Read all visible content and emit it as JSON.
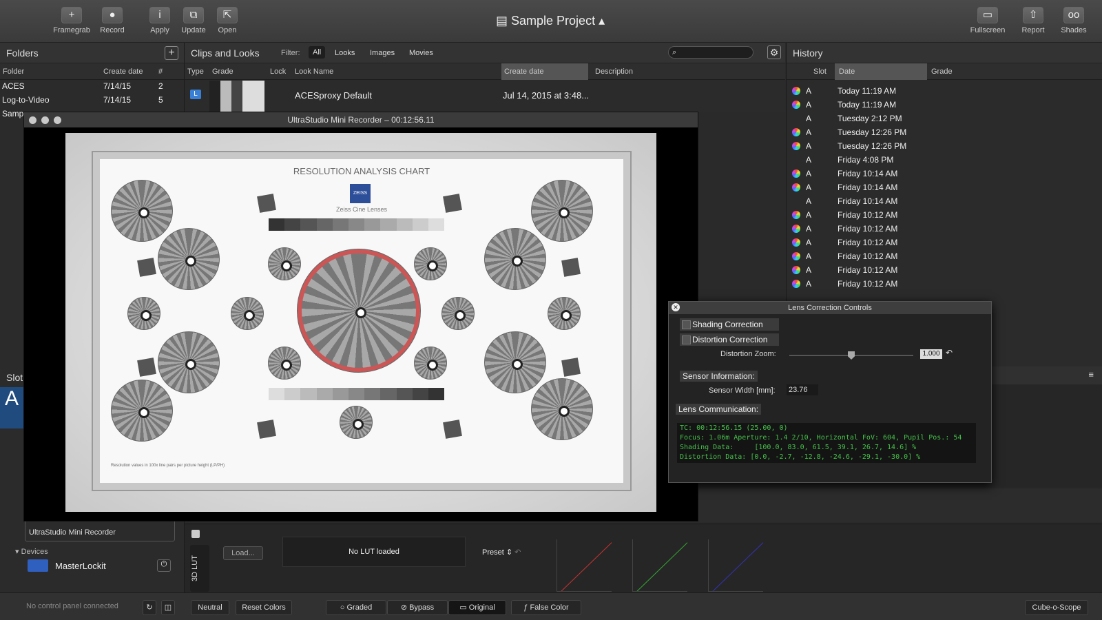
{
  "toolbar": {
    "buttons": [
      "Framegrab",
      "Record",
      "Apply",
      "Update",
      "Open"
    ],
    "right_buttons": [
      "Fullscreen",
      "Report",
      "Shades"
    ],
    "project_title": "Sample Project"
  },
  "folders": {
    "title": "Folders",
    "columns": [
      "Folder",
      "Create date",
      "#"
    ],
    "rows": [
      {
        "name": "ACES",
        "date": "7/14/15",
        "count": "2"
      },
      {
        "name": "Log-to-Video",
        "date": "7/14/15",
        "count": "5"
      },
      {
        "name": "Samp",
        "date": "",
        "count": ""
      }
    ],
    "add_icon": "plus-icon"
  },
  "clips": {
    "title": "Clips and Looks",
    "filter_label": "Filter:",
    "filters": [
      "All",
      "Looks",
      "Images",
      "Movies"
    ],
    "columns": [
      "Type",
      "Grade",
      "Lock",
      "Look Name",
      "Create date",
      "Description"
    ],
    "rows": [
      {
        "type": "L",
        "look_name": "ACESproxy Default",
        "date": "Jul 14, 2015 at 3:48..."
      }
    ]
  },
  "history": {
    "title": "History",
    "columns": [
      "Slot",
      "Date",
      "Grade"
    ],
    "rows": [
      {
        "slot": "A",
        "date": "Today 11:19 AM",
        "grade": true
      },
      {
        "slot": "A",
        "date": "Today 11:19 AM",
        "grade": true
      },
      {
        "slot": "A",
        "date": "Tuesday 2:12 PM",
        "grade": false
      },
      {
        "slot": "A",
        "date": "Tuesday 12:26 PM",
        "grade": true
      },
      {
        "slot": "A",
        "date": "Tuesday 12:26 PM",
        "grade": true
      },
      {
        "slot": "A",
        "date": "Friday 4:08 PM",
        "grade": false
      },
      {
        "slot": "A",
        "date": "Friday 10:14 AM",
        "grade": true
      },
      {
        "slot": "A",
        "date": "Friday 10:14 AM",
        "grade": true
      },
      {
        "slot": "A",
        "date": "Friday 10:14 AM",
        "grade": false
      },
      {
        "slot": "A",
        "date": "Friday 10:12 AM",
        "grade": true
      },
      {
        "slot": "A",
        "date": "Friday 10:12 AM",
        "grade": true
      },
      {
        "slot": "A",
        "date": "Friday 10:12 AM",
        "grade": true
      },
      {
        "slot": "A",
        "date": "Friday 10:12 AM",
        "grade": true
      },
      {
        "slot": "A",
        "date": "Friday 10:12 AM",
        "grade": true
      },
      {
        "slot": "A",
        "date": "Friday 10:12 AM",
        "grade": true
      }
    ]
  },
  "viewer": {
    "title": "UltraStudio Mini Recorder – 00:12:56.11",
    "chart_title": "RESOLUTION ANALYSIS CHART",
    "brand": "ZEISS",
    "brand_sub": "Zeiss Cine Lenses",
    "foot_left": "Resolution values in 100x line pairs per picture height (LP/PH)"
  },
  "lens": {
    "title": "Lens Correction Controls",
    "shading": "Shading Correction",
    "distortion": "Distortion Correction",
    "zoom_label": "Distortion Zoom:",
    "zoom_value": "1.000",
    "sensor_title": "Sensor Information:",
    "sensor_label": "Sensor Width [mm]:",
    "sensor_value": "23.76",
    "comm_title": "Lens Communication:",
    "console": [
      "TC: 00:12:56.15 (25.00, 0)",
      "Focus: 1.06m Aperture: 1.4 2/10, Horizontal FoV: 604, Pupil Pos.: 54",
      "Shading Data:     [100.0, 83.0, 61.5, 39.1, 26.7, 14.6] %",
      "Distortion Data: [0.0, -2.7, -12.8, -24.6, -29.1, -30.0] %"
    ]
  },
  "left_lower": {
    "slot_label": "Slot",
    "slot_letter": "A",
    "device_caption": "UltraStudio Mini Recorder",
    "devices_title": "Devices",
    "device_name": "MasterLockit"
  },
  "lut": {
    "label": "3D LUT",
    "load": "Load...",
    "status": "No LUT loaded",
    "preset": "Preset"
  },
  "status": {
    "panel": "No control panel connected",
    "neutral": "Neutral",
    "reset": "Reset Colors",
    "graded": "Graded",
    "bypass": "Bypass",
    "original": "Original",
    "false_color": "False Color",
    "scope": "Cube-o-Scope"
  }
}
